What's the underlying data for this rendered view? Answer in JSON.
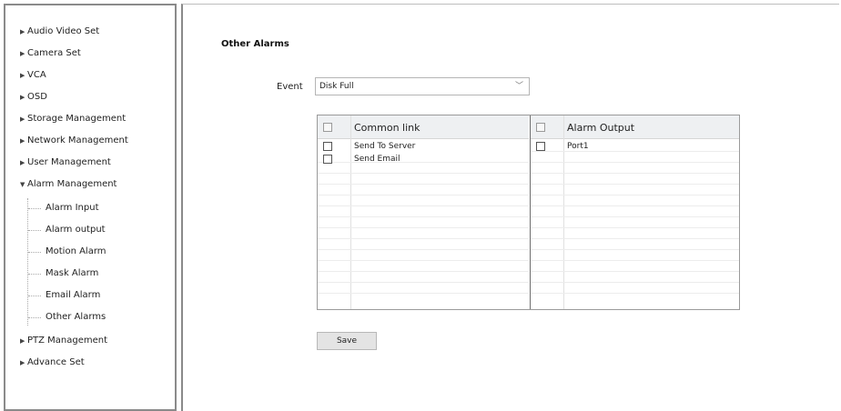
{
  "sidebar": {
    "items": [
      {
        "label": "Audio Video Set"
      },
      {
        "label": "Camera Set"
      },
      {
        "label": "VCA"
      },
      {
        "label": "OSD"
      },
      {
        "label": "Storage Management"
      },
      {
        "label": "Network Management"
      },
      {
        "label": "User Management"
      },
      {
        "label": "Alarm Management"
      },
      {
        "label": "PTZ Management"
      },
      {
        "label": "Advance Set"
      }
    ],
    "alarm_children": [
      {
        "label": "Alarm Input"
      },
      {
        "label": "Alarm output"
      },
      {
        "label": "Motion Alarm"
      },
      {
        "label": "Mask Alarm"
      },
      {
        "label": "Email Alarm"
      },
      {
        "label": "Other Alarms"
      }
    ]
  },
  "main": {
    "title": "Other Alarms",
    "event_label": "Event",
    "event_value": "Disk Full",
    "common_link": {
      "header": "Common link",
      "rows": [
        {
          "label": "Send To Server",
          "checked": false
        },
        {
          "label": "Send Email",
          "checked": false
        }
      ]
    },
    "alarm_output": {
      "header": "Alarm Output",
      "rows": [
        {
          "label": "Port1",
          "checked": false
        }
      ]
    },
    "save_label": "Save"
  }
}
